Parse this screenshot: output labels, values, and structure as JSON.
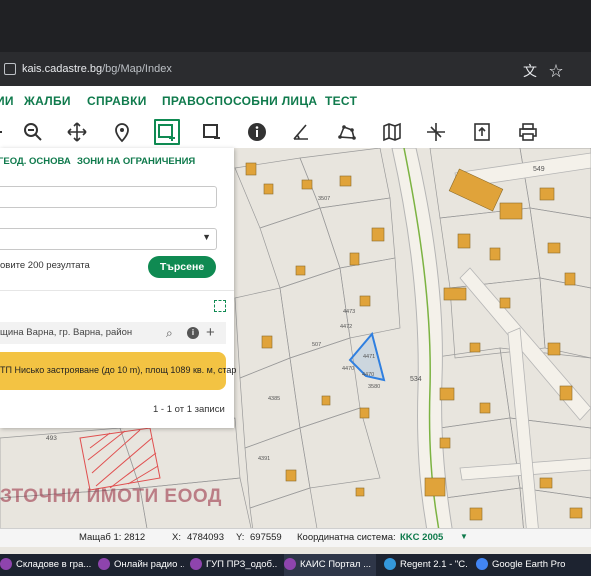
{
  "browser": {
    "url_domain": "kais.cadastre.bg",
    "url_path": "/bg/Map/Index"
  },
  "menu": {
    "items": [
      "ИИ",
      "ЖАЛБИ",
      "СПРАВКИ",
      "ПРАВОСПОСОБНИ ЛИЦА",
      "ТЕСТ"
    ]
  },
  "panel": {
    "tabs": [
      "ГЕОД. ОСНОВА",
      "ЗОНИ НА ОГРАНИЧЕНИЯ"
    ],
    "results_note": "овите 200 резултата",
    "search_button": "Търсене",
    "location_crumb": "щина Варна, гр. Варна, район",
    "result_text": "ТП Нисько застрояване (до 10 m), площ 1089 кв. м, стар",
    "paging": "1 - 1 от 1 записи"
  },
  "map": {
    "parcel_labels": [
      "4471",
      "4472",
      "4473",
      "4470",
      "507",
      "4470",
      "3580",
      "534",
      "549",
      "493",
      "4385",
      "4391",
      "3507"
    ],
    "watermark": "ЗТОЧНИ ИМОТИ ЕООД",
    "highlight_color": "#2f7fe0"
  },
  "status": {
    "scale_label": "Мащаб 1:",
    "scale_value": "2812",
    "x_label": "X:",
    "x_value": "4784093",
    "y_label": "Y:",
    "y_value": "697559",
    "crs_label": "Координатна система:",
    "crs_value": "КKC 2005"
  },
  "taskbar": {
    "items": [
      "Складове в гра...",
      "Онлайн радио ...",
      "ГУП ПРЗ_одоб...",
      "КАИС Портал ...",
      "Regent 2.1 - \"C...",
      "Google Earth Pro"
    ]
  }
}
